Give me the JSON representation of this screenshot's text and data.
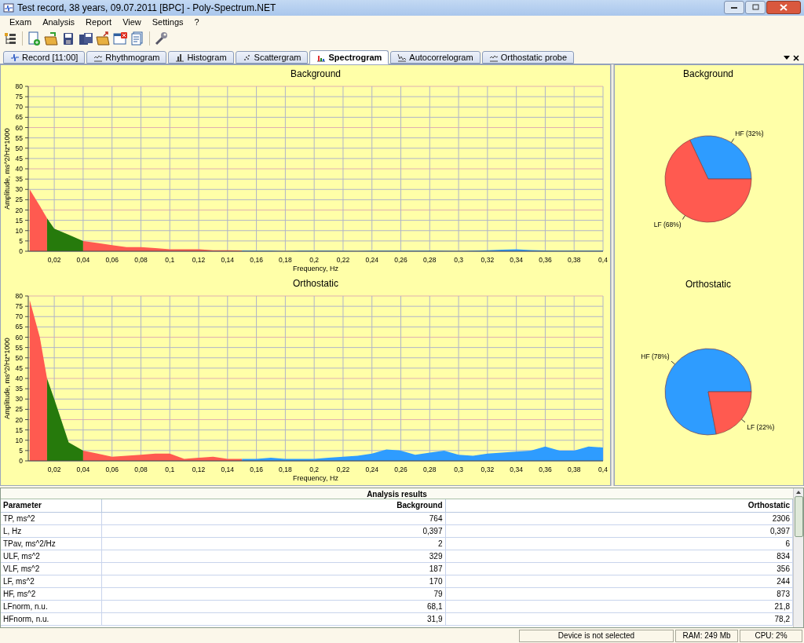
{
  "window": {
    "title": "Test record, 38 years, 09.07.2011 [BPC] - Poly-Spectrum.NET"
  },
  "menu": [
    "Exam",
    "Analysis",
    "Report",
    "View",
    "Settings",
    "?"
  ],
  "tabs": [
    {
      "label": "Record [11:00]",
      "selected": false,
      "kind": "ecg"
    },
    {
      "label": "Rhythmogram",
      "selected": false,
      "kind": "line"
    },
    {
      "label": "Histogram",
      "selected": false,
      "kind": "bars"
    },
    {
      "label": "Scattergram",
      "selected": false,
      "kind": "dots"
    },
    {
      "label": "Spectrogram",
      "selected": true,
      "kind": "spectrum"
    },
    {
      "label": "Autocorrelogram",
      "selected": false,
      "kind": "decay"
    },
    {
      "label": "Orthostatic probe",
      "selected": false,
      "kind": "line"
    }
  ],
  "spectra": [
    {
      "chart_data": {
        "type": "area",
        "title": "Background",
        "xlabel": "Frequency, Hz",
        "ylabel": "Amplitude, ms^2/Hz*1000",
        "grid": true,
        "x": [
          0.003,
          0.01,
          0.015,
          0.02,
          0.03,
          0.04,
          0.05,
          0.06,
          0.07,
          0.08,
          0.09,
          0.1,
          0.11,
          0.12,
          0.13,
          0.14,
          0.15,
          0.16,
          0.17,
          0.18,
          0.19,
          0.2,
          0.21,
          0.22,
          0.23,
          0.24,
          0.25,
          0.26,
          0.27,
          0.28,
          0.29,
          0.3,
          0.31,
          0.32,
          0.33,
          0.34,
          0.35,
          0.36,
          0.37,
          0.38,
          0.39,
          0.4
        ],
        "xlim": [
          0.002,
          0.4
        ],
        "ylim": [
          0,
          80
        ],
        "xticks": [
          {
            "value": 0.02,
            "label": "0,02"
          },
          {
            "value": 0.04,
            "label": "0,04"
          },
          {
            "value": 0.06,
            "label": "0,06"
          },
          {
            "value": 0.08,
            "label": "0,08"
          },
          {
            "value": 0.1,
            "label": "0,1"
          },
          {
            "value": 0.12,
            "label": "0,12"
          },
          {
            "value": 0.14,
            "label": "0,14"
          },
          {
            "value": 0.16,
            "label": "0,16"
          },
          {
            "value": 0.18,
            "label": "0,18"
          },
          {
            "value": 0.2,
            "label": "0,2"
          },
          {
            "value": 0.22,
            "label": "0,22"
          },
          {
            "value": 0.24,
            "label": "0,24"
          },
          {
            "value": 0.26,
            "label": "0,26"
          },
          {
            "value": 0.28,
            "label": "0,28"
          },
          {
            "value": 0.3,
            "label": "0,3"
          },
          {
            "value": 0.32,
            "label": "0,32"
          },
          {
            "value": 0.34,
            "label": "0,34"
          },
          {
            "value": 0.36,
            "label": "0,36"
          },
          {
            "value": 0.38,
            "label": "0,38"
          },
          {
            "value": 0.4,
            "label": "0,4"
          }
        ],
        "yticks": [
          0,
          5,
          10,
          15,
          20,
          25,
          30,
          35,
          40,
          45,
          50,
          55,
          60,
          65,
          70,
          75,
          80
        ],
        "series": [
          {
            "color": "#ff5a50",
            "values": [
              30,
              22,
              16,
              null,
              null,
              null,
              null,
              null,
              null,
              null,
              null,
              null,
              null,
              null,
              null,
              null,
              null,
              null,
              null,
              null,
              null,
              null,
              null,
              null,
              null,
              null,
              null,
              null,
              null,
              null,
              null,
              null,
              null,
              null,
              null,
              null,
              null,
              null,
              null,
              null,
              null,
              null
            ]
          },
          {
            "color": "#267a0c",
            "values": [
              null,
              null,
              16,
              11,
              8,
              5,
              null,
              null,
              null,
              null,
              null,
              null,
              null,
              null,
              null,
              null,
              null,
              null,
              null,
              null,
              null,
              null,
              null,
              null,
              null,
              null,
              null,
              null,
              null,
              null,
              null,
              null,
              null,
              null,
              null,
              null,
              null,
              null,
              null,
              null,
              null,
              null
            ]
          },
          {
            "color": "#ff5a50",
            "values": [
              null,
              null,
              null,
              null,
              null,
              5,
              4,
              3,
              2,
              2,
              1.5,
              1,
              1,
              1,
              0.5,
              0.5,
              0.4,
              null,
              null,
              null,
              null,
              null,
              null,
              null,
              null,
              null,
              null,
              null,
              null,
              null,
              null,
              null,
              null,
              null,
              null,
              null,
              null,
              null,
              null,
              null,
              null,
              null
            ]
          },
          {
            "color": "#2e9cff",
            "values": [
              null,
              null,
              null,
              null,
              null,
              null,
              null,
              null,
              null,
              null,
              null,
              null,
              null,
              null,
              null,
              null,
              0.4,
              0.3,
              0.3,
              0,
              0.3,
              0.3,
              0.3,
              0.2,
              0.1,
              0.3,
              0.3,
              0.3,
              0.3,
              0.3,
              0.2,
              0.1,
              0.3,
              0.5,
              0.8,
              1,
              0.6,
              0.4,
              0.3,
              0.3,
              0.3,
              0.3
            ]
          }
        ]
      }
    },
    {
      "chart_data": {
        "type": "area",
        "title": "Orthostatic",
        "xlabel": "Frequency, Hz",
        "ylabel": "Amplitude, ms^2/Hz*1000",
        "grid": true,
        "x": [
          0.003,
          0.01,
          0.015,
          0.02,
          0.03,
          0.04,
          0.05,
          0.06,
          0.07,
          0.08,
          0.09,
          0.1,
          0.11,
          0.12,
          0.13,
          0.14,
          0.15,
          0.16,
          0.17,
          0.18,
          0.19,
          0.2,
          0.21,
          0.22,
          0.23,
          0.24,
          0.25,
          0.26,
          0.27,
          0.28,
          0.29,
          0.3,
          0.31,
          0.32,
          0.33,
          0.34,
          0.35,
          0.36,
          0.37,
          0.38,
          0.39,
          0.4
        ],
        "xlim": [
          0.002,
          0.4
        ],
        "ylim": [
          0,
          80
        ],
        "xticks": [
          {
            "value": 0.02,
            "label": "0,02"
          },
          {
            "value": 0.04,
            "label": "0,04"
          },
          {
            "value": 0.06,
            "label": "0,06"
          },
          {
            "value": 0.08,
            "label": "0,08"
          },
          {
            "value": 0.1,
            "label": "0,1"
          },
          {
            "value": 0.12,
            "label": "0,12"
          },
          {
            "value": 0.14,
            "label": "0,14"
          },
          {
            "value": 0.16,
            "label": "0,16"
          },
          {
            "value": 0.18,
            "label": "0,18"
          },
          {
            "value": 0.2,
            "label": "0,2"
          },
          {
            "value": 0.22,
            "label": "0,22"
          },
          {
            "value": 0.24,
            "label": "0,24"
          },
          {
            "value": 0.26,
            "label": "0,26"
          },
          {
            "value": 0.28,
            "label": "0,28"
          },
          {
            "value": 0.3,
            "label": "0,3"
          },
          {
            "value": 0.32,
            "label": "0,32"
          },
          {
            "value": 0.34,
            "label": "0,34"
          },
          {
            "value": 0.36,
            "label": "0,36"
          },
          {
            "value": 0.38,
            "label": "0,38"
          },
          {
            "value": 0.4,
            "label": "0,4"
          }
        ],
        "yticks": [
          0,
          5,
          10,
          15,
          20,
          25,
          30,
          35,
          40,
          45,
          50,
          55,
          60,
          65,
          70,
          75,
          80
        ],
        "series": [
          {
            "color": "#ff5a50",
            "values": [
              78,
              60,
              40,
              null,
              null,
              null,
              null,
              null,
              null,
              null,
              null,
              null,
              null,
              null,
              null,
              null,
              null,
              null,
              null,
              null,
              null,
              null,
              null,
              null,
              null,
              null,
              null,
              null,
              null,
              null,
              null,
              null,
              null,
              null,
              null,
              null,
              null,
              null,
              null,
              null,
              null,
              null
            ]
          },
          {
            "color": "#267a0c",
            "values": [
              null,
              null,
              40,
              30,
              9,
              5,
              null,
              null,
              null,
              null,
              null,
              null,
              null,
              null,
              null,
              null,
              null,
              null,
              null,
              null,
              null,
              null,
              null,
              null,
              null,
              null,
              null,
              null,
              null,
              null,
              null,
              null,
              null,
              null,
              null,
              null,
              null,
              null,
              null,
              null,
              null,
              null
            ]
          },
          {
            "color": "#ff5a50",
            "values": [
              null,
              null,
              null,
              null,
              null,
              5,
              3.5,
              2,
              2.5,
              3,
              3.5,
              3.5,
              1,
              1.5,
              2,
              1,
              1,
              null,
              null,
              null,
              null,
              null,
              null,
              null,
              null,
              null,
              null,
              null,
              null,
              null,
              null,
              null,
              null,
              null,
              null,
              null,
              null,
              null,
              null,
              null,
              null,
              null
            ]
          },
          {
            "color": "#2e9cff",
            "values": [
              null,
              null,
              null,
              null,
              null,
              null,
              null,
              null,
              null,
              null,
              null,
              null,
              null,
              null,
              null,
              null,
              1,
              1,
              1.5,
              1,
              1,
              1,
              1.5,
              2,
              2.5,
              3.5,
              5.5,
              5,
              3,
              4,
              5,
              3,
              2.5,
              3.5,
              4,
              4.5,
              5,
              7,
              5,
              5,
              7,
              6.5
            ]
          }
        ]
      }
    }
  ],
  "pies": [
    {
      "chart_data": {
        "type": "pie",
        "title": "Background",
        "categories": [
          "HF (32%)",
          "LF (68%)"
        ],
        "values": [
          32,
          68
        ],
        "colors": [
          "#2e9cff",
          "#ff5a50"
        ]
      }
    },
    {
      "chart_data": {
        "type": "pie",
        "title": "Orthostatic",
        "categories": [
          "HF (78%)",
          "LF (22%)"
        ],
        "values": [
          78,
          22
        ],
        "colors": [
          "#2e9cff",
          "#ff5a50"
        ]
      }
    }
  ],
  "table": {
    "title": "Analysis results",
    "columns": [
      "Parameter",
      "Background",
      "Orthostatic"
    ],
    "rows": [
      [
        "TP, ms^2",
        "764",
        "2306"
      ],
      [
        "L, Hz",
        "0,397",
        "0,397"
      ],
      [
        "TPav, ms^2/Hz",
        "2",
        "6"
      ],
      [
        "ULF, ms^2",
        "329",
        "834"
      ],
      [
        "VLF, ms^2",
        "187",
        "356"
      ],
      [
        "LF, ms^2",
        "170",
        "244"
      ],
      [
        "HF, ms^2",
        "79",
        "873"
      ],
      [
        "LFnorm, n.u.",
        "68,1",
        "21,8"
      ],
      [
        "HFnorm, n.u.",
        "31,9",
        "78,2"
      ]
    ]
  },
  "status_bar": [
    "Device is not selected",
    "RAM: 249 Mb",
    "CPU: 2%"
  ]
}
